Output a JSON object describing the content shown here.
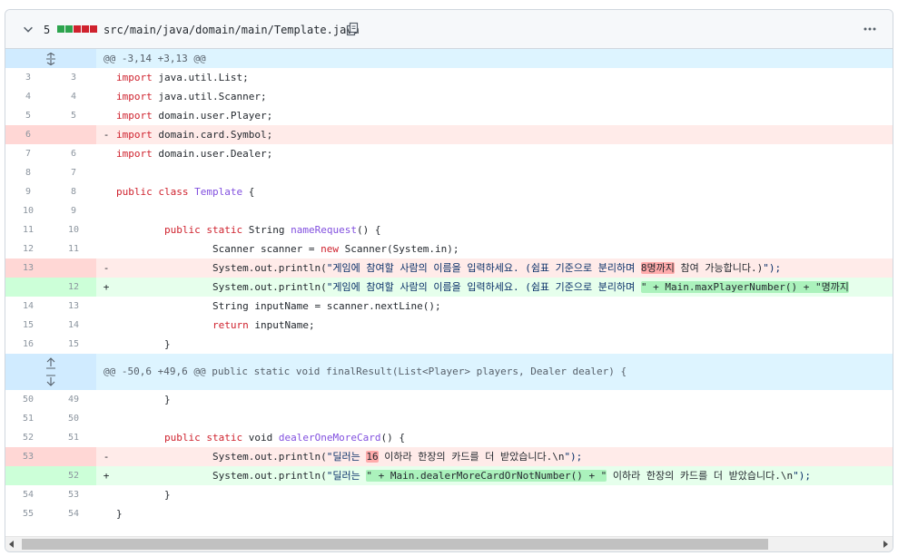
{
  "header": {
    "change_count": "5",
    "diffstat": [
      "add",
      "add",
      "del",
      "del",
      "del"
    ],
    "file_path": "src/main/java/domain/main/Template.java",
    "icons": {
      "collapse": "chevron-down-icon",
      "copy": "copy-icon",
      "menu": "kebab-horizontal-icon"
    }
  },
  "hunks": [
    {
      "header": "@@ -3,14 +3,13 @@"
    },
    {
      "header": "@@ -50,6 +49,6 @@ public static void finalResult(List<Player> players, Dealer dealer) {"
    }
  ],
  "lines": [
    {
      "old": "3",
      "new": "3",
      "code": "import java.util.List;"
    },
    {
      "old": "4",
      "new": "4",
      "code": "import java.util.Scanner;"
    },
    {
      "old": "5",
      "new": "5",
      "code": "import domain.user.Player;"
    },
    {
      "old": "6",
      "new": "",
      "marker": "-",
      "code": "import domain.card.Symbol;"
    },
    {
      "old": "7",
      "new": "6",
      "code": "import domain.user.Dealer;"
    },
    {
      "old": "8",
      "new": "7",
      "code": ""
    },
    {
      "old": "9",
      "new": "8",
      "code": "public class Template {"
    },
    {
      "old": "10",
      "new": "9",
      "code": ""
    },
    {
      "old": "11",
      "new": "10",
      "code": "        public static String nameRequest() {"
    },
    {
      "old": "12",
      "new": "11",
      "code": "                Scanner scanner = new Scanner(System.in);"
    },
    {
      "old": "13",
      "new": "",
      "marker": "-",
      "code_pre": "                System.out.println(\"게임에 참여할 사람의 이름을 입력하세요. (쉼표 기준으로 분리하며 ",
      "code_hl": "8명까지",
      "code_post": " 참여 가능합니다.)\");"
    },
    {
      "old": "",
      "new": "12",
      "marker": "+",
      "code_pre": "                System.out.println(\"게임에 참여할 사람의 이름을 입력하세요. (쉼표 기준으로 분리하며 ",
      "code_hl": "\" + Main.maxPlayerNumber() + \"명까지",
      "code_post": ""
    },
    {
      "old": "14",
      "new": "13",
      "code": "                String inputName = scanner.nextLine();"
    },
    {
      "old": "15",
      "new": "14",
      "code": "                return inputName;"
    },
    {
      "old": "16",
      "new": "15",
      "code": "        }"
    },
    {
      "old": "50",
      "new": "49",
      "code": "        }"
    },
    {
      "old": "51",
      "new": "50",
      "code": ""
    },
    {
      "old": "52",
      "new": "51",
      "code": "        public static void dealerOneMoreCard() {"
    },
    {
      "old": "53",
      "new": "",
      "marker": "-",
      "code_pre": "                System.out.println(\"딜러는 ",
      "code_hl": "16",
      "code_post": " 이하라 한장의 카드를 더 받았습니다.\\n\");"
    },
    {
      "old": "",
      "new": "52",
      "marker": "+",
      "code_pre": "                System.out.println(\"딜러는 ",
      "code_hl": "\" + Main.dealerMoreCardOrNotNumber() + \"",
      "code_post": " 이하라 한장의 카드를 더 받았습니다.\\n\");"
    },
    {
      "old": "54",
      "new": "53",
      "code": "        }"
    },
    {
      "old": "55",
      "new": "54",
      "code": "}"
    }
  ],
  "scrollbar": {
    "position_fraction": 0.0,
    "visible_fraction": 0.88
  }
}
